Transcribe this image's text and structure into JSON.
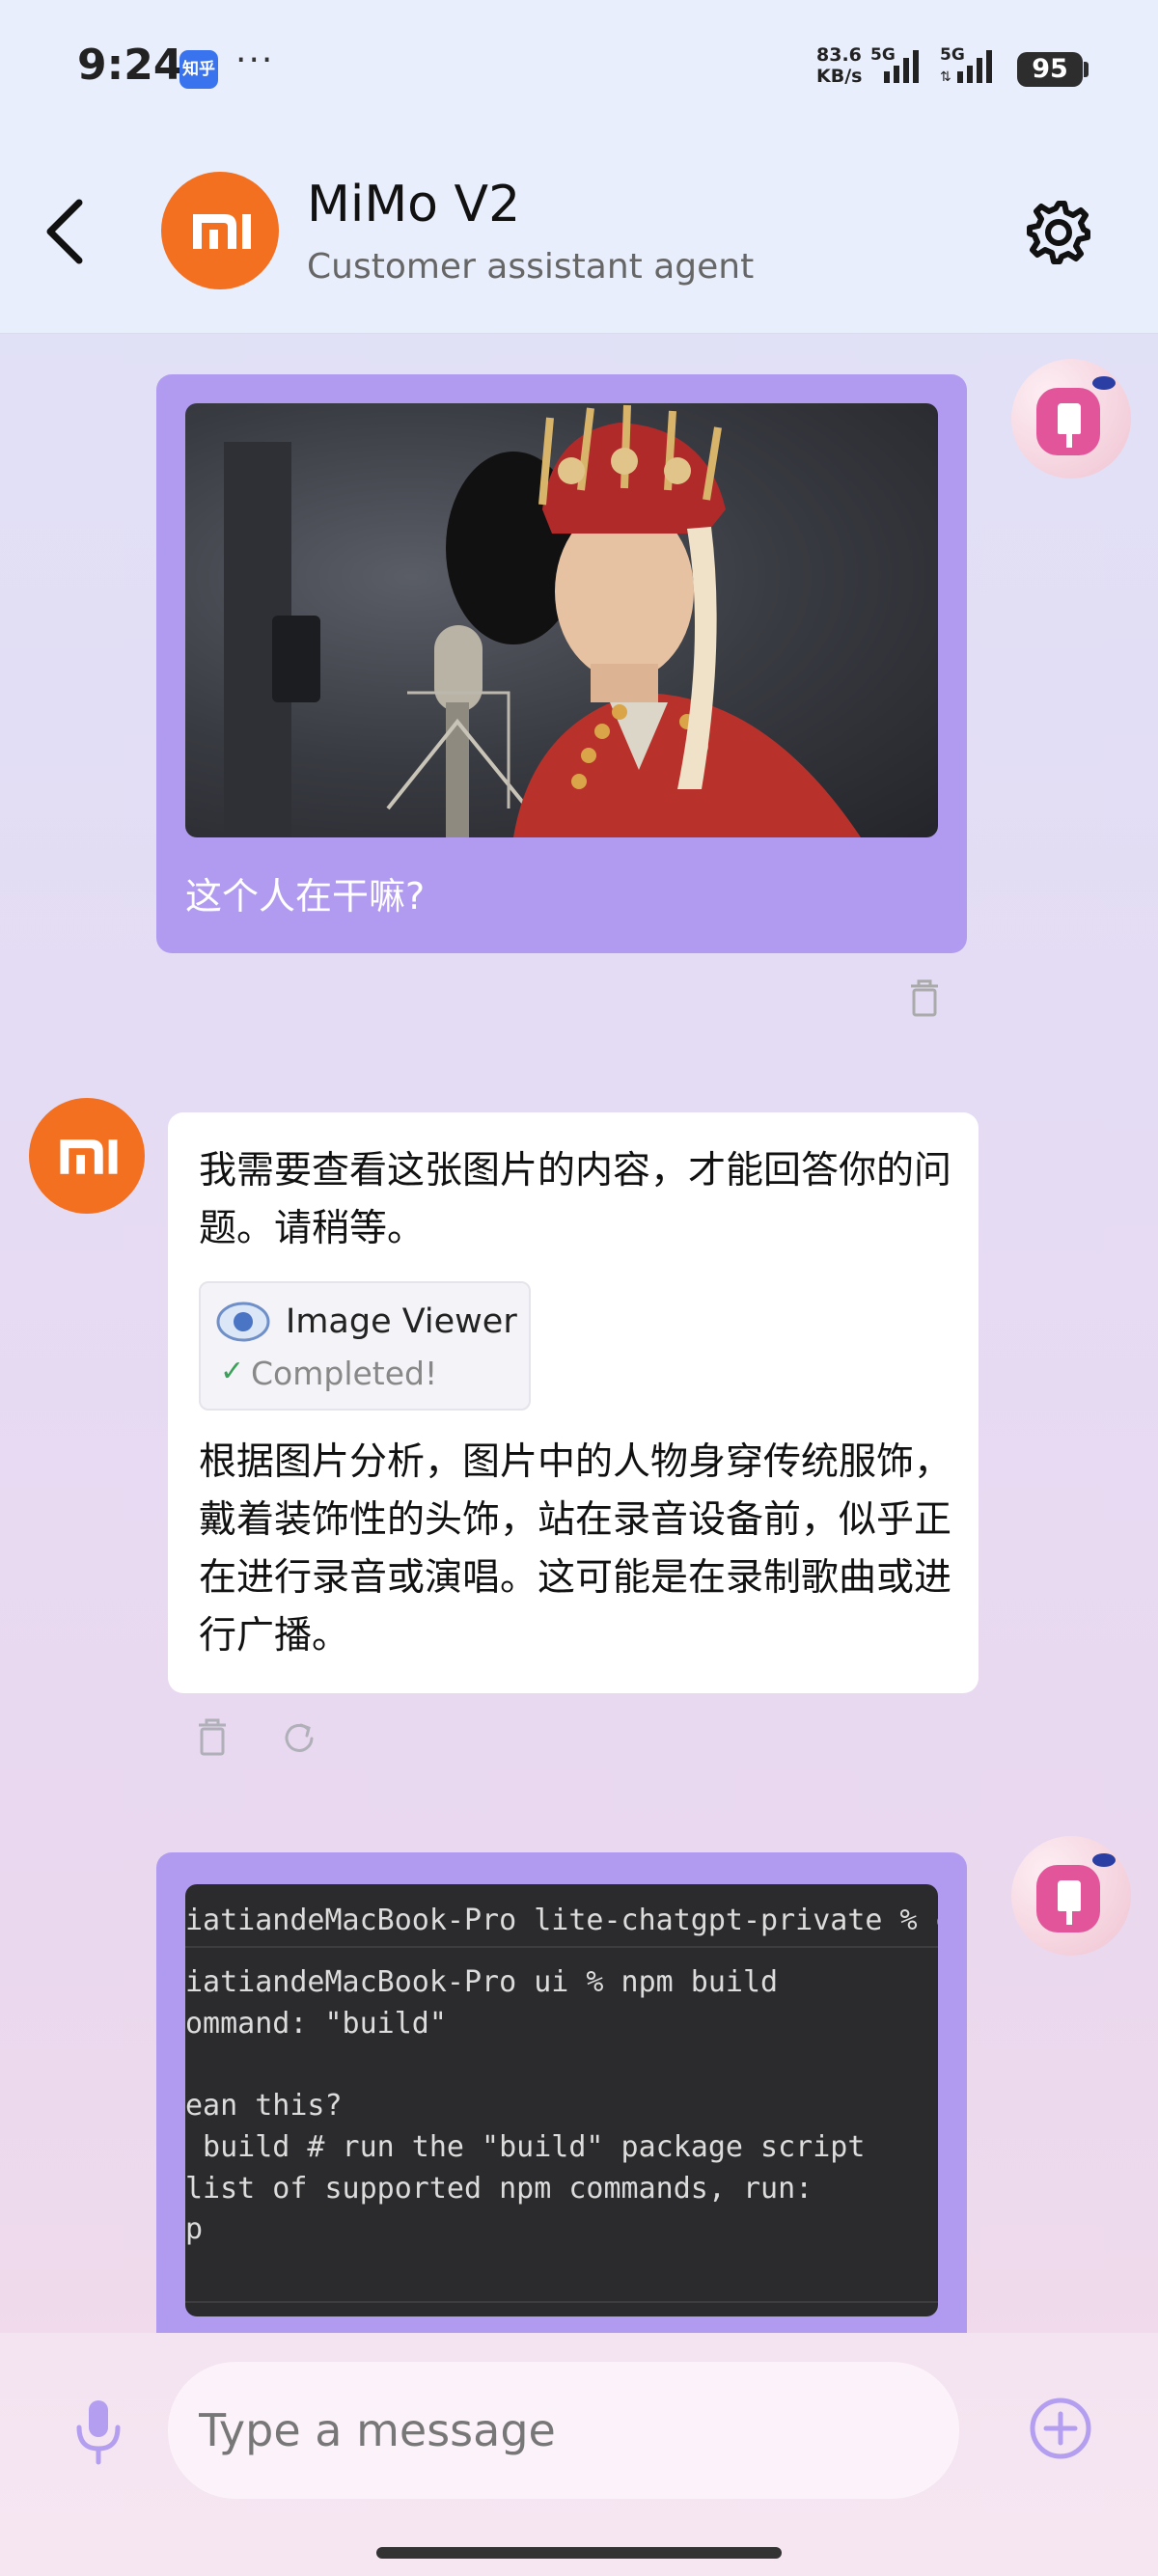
{
  "status_bar": {
    "time": "9:24",
    "notification_app": "知乎",
    "more": "···",
    "net_speed_value": "83.6",
    "net_speed_unit": "KB/s",
    "network_1": "5G",
    "network_2": "5G",
    "battery": "95"
  },
  "header": {
    "title": "MiMo V2",
    "subtitle": "Customer assistant agent"
  },
  "messages": {
    "user_1": {
      "text": "这个人在干嘛?"
    },
    "ai_1": {
      "intro": "我需要查看这张图片的内容，才能回答你的问题。请稍等。",
      "tool_name": "Image Viewer",
      "tool_check": "✓",
      "tool_status": "Completed!",
      "answer": "根据图片分析，图片中的人物身穿传统服饰，戴着装饰性的头饰，站在录音设备前，似乎正在进行录音或演唱。这可能是在录制歌曲或进行广播。"
    },
    "user_2": {
      "terminal_lines": [
        "iatiandeMacBook-Pro lite-chatgpt-private % c",
        "iatiandeMacBook-Pro ui % npm build",
        "ommand: \"build\"",
        "",
        "ean this?",
        " build # run the \"build\" package script",
        "list of supported npm commands, run:",
        "p"
      ]
    }
  },
  "input": {
    "placeholder": "Type a message"
  },
  "icons": {
    "back": "chevron-left-icon",
    "settings": "gear-icon",
    "delete": "trash-icon",
    "regenerate": "refresh-icon",
    "mic": "microphone-icon",
    "add": "plus-circle-icon",
    "tool": "eye-icon"
  },
  "colors": {
    "brand_orange": "#f37021",
    "user_bubble": "#b19bf0",
    "accent_purple": "#b39ef0"
  }
}
